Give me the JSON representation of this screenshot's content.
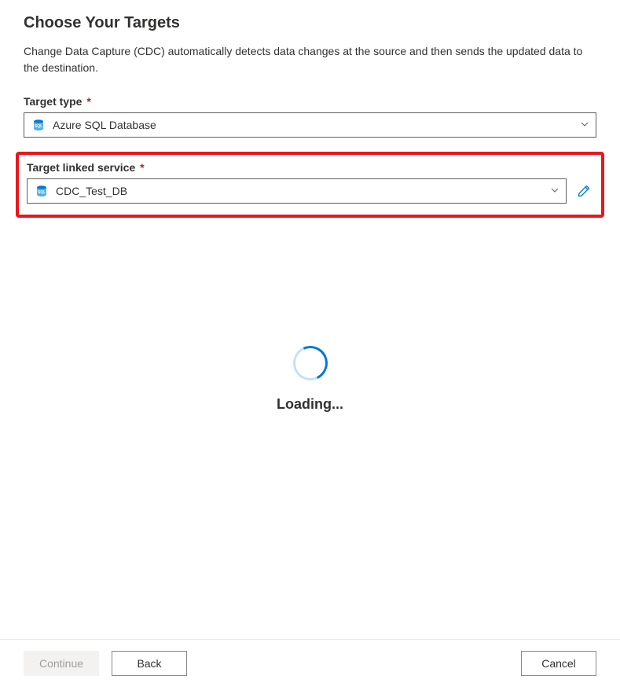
{
  "title": "Choose Your Targets",
  "description": "Change Data Capture (CDC) automatically detects data changes at the source and then sends the updated data to the destination.",
  "targetType": {
    "label": "Target type",
    "icon": "azure-sql-icon",
    "value": "Azure SQL Database"
  },
  "targetLinkedService": {
    "label": "Target linked service",
    "icon": "azure-sql-icon",
    "value": "CDC_Test_DB"
  },
  "loading": {
    "text": "Loading..."
  },
  "buttons": {
    "continue": "Continue",
    "back": "Back",
    "cancel": "Cancel"
  },
  "colors": {
    "accent": "#0078d4",
    "required": "#a4262c",
    "highlight": "#e8171c"
  }
}
